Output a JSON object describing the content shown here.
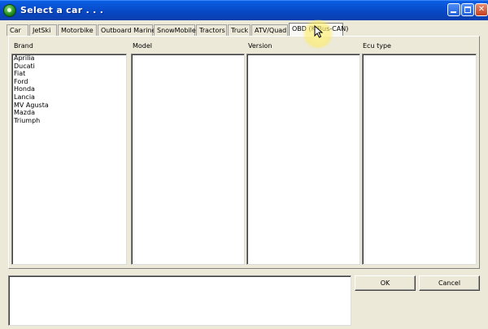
{
  "window": {
    "title": "Select a car . . .",
    "title_bar_color": "#0a5fe6"
  },
  "tabs": [
    {
      "label": "Car",
      "active": false
    },
    {
      "label": "JetSki",
      "active": false
    },
    {
      "label": "Motorbike",
      "active": false
    },
    {
      "label": "Outboard Marine",
      "active": false
    },
    {
      "label": "SnowMobile",
      "active": false
    },
    {
      "label": "Tractors",
      "active": false
    },
    {
      "label": "Truck",
      "active": false
    },
    {
      "label": "ATV/Quad",
      "active": false
    },
    {
      "label": "OBD (K/Bus-CAN)",
      "active": true
    }
  ],
  "columns": {
    "brand": {
      "header": "Brand",
      "items": [
        "Aprilia",
        "Ducati",
        "Fiat",
        "Ford",
        "Honda",
        "Lancia",
        "MV Agusta",
        "Mazda",
        "Triumph"
      ]
    },
    "model": {
      "header": "Model",
      "items": []
    },
    "version": {
      "header": "Version",
      "items": []
    },
    "ecu_type": {
      "header": "Ecu type",
      "items": []
    }
  },
  "info_box": {
    "text": ""
  },
  "buttons": {
    "ok_label": "OK",
    "cancel_label": "Cancel"
  },
  "icons": {
    "app": "car-app-icon",
    "minimize": "minimize-icon",
    "maximize": "maximize-icon",
    "close": "close-icon",
    "pointer": "mouse-pointer-icon"
  },
  "colors": {
    "dialog_bg": "#ece9d8",
    "cursor_highlight": "#fff07a"
  }
}
